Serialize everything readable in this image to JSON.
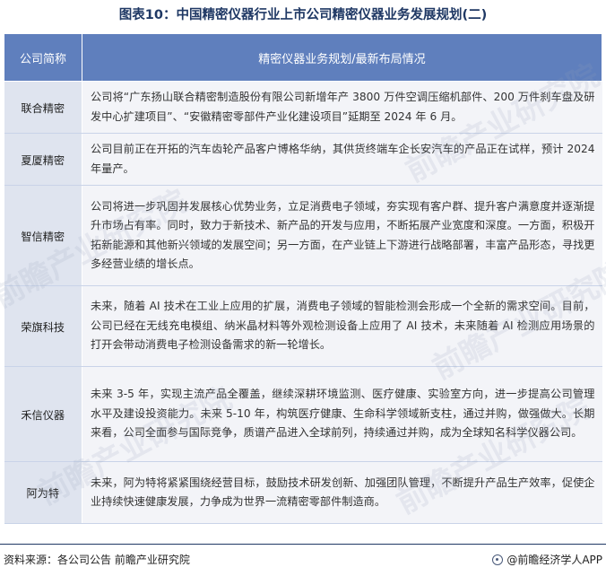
{
  "title": "图表10：中国精密仪器行业上市公司精密仪器业务发展规划(二)",
  "table": {
    "headers": [
      "公司简称",
      "精密仪器业务规划/最新布局情况"
    ],
    "rows": [
      {
        "company": "联合精密",
        "plan": "公司将“广东扬山联合精密制造股份有限公司新增年产 3800 万件空调压缩机部件、200 万件刹车盘及研发中心扩建项目”、“安徽精密零部件产业化建设项目”延期至 2024 年 6 月。"
      },
      {
        "company": "夏厦精密",
        "plan": "公司目前正在开拓的汽车齿轮产品客户博格华纳，其供货终端车企长安汽车的产品正在试样，预计 2024 年量产。"
      },
      {
        "company": "智信精密",
        "plan": "公司将进一步巩固并发展核心优势业务，立足消费电子领域，夯实现有客户群、提升客户满意度并逐渐提升市场占有率。同时，致力于新技术、新产品的开发与应用，不断拓展产业宽度和深度。一方面，积极开拓新能源和其他新兴领域的发展空间；另一方面，在产业链上下游进行战略部署，丰富产品形态，寻找更多经营业绩的增长点。"
      },
      {
        "company": "荣旗科技",
        "plan": "未来，随着 AI 技术在工业上应用的扩展，消费电子领域的智能检测会形成一个全新的需求空间。目前，公司已经在无线充电模组、纳米晶材料等外观检测设备上应用了 AI 技术，未来随着 AI 检测应用场景的打开会带动消费电子检测设备需求的新一轮增长。"
      },
      {
        "company": "禾信仪器",
        "plan": "未来 3-5 年，实现主流产品全覆盖，继续深耕环境监测、医疗健康、实验室方向，进一步提高公司管理水平及建设投资能力。未来 5-10 年，构筑医疗健康、生命科学领域新支柱，通过并购，做强做大。长期来看，公司全面参与国际竞争，质谱产品进入全球前列，持续通过并购，成为全球知名科学仪器公司。"
      },
      {
        "company": "阿为特",
        "plan": "未来，阿为特将紧紧围绕经营目标，鼓励技术研发创新、加强团队管理，不断提升产品生产效率，促使企业持续快速健康发展，力争成为世界一流精密零部件制造商。"
      }
    ]
  },
  "watermark": "前瞻产业研究院",
  "footer": {
    "source": "资料来源：各公司公告 前瞻产业研究院",
    "brand_icon": "brand-logo-icon",
    "brand": "@前瞻经济学人APP"
  }
}
